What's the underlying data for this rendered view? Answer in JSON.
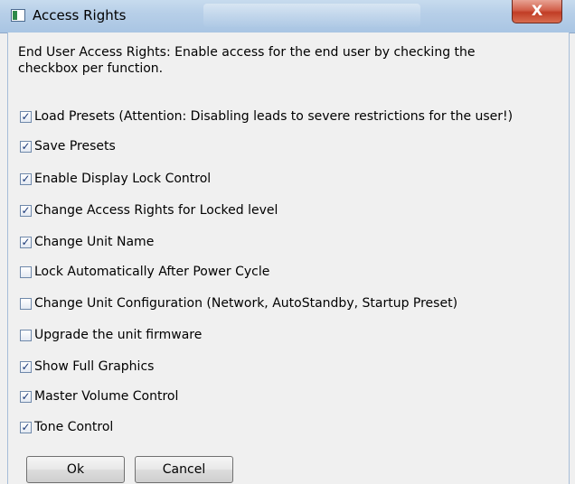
{
  "window": {
    "title": "Access Rights",
    "close_glyph": "X"
  },
  "intro_text": "End User Access Rights: Enable access for the end user by checking the checkbox per function.",
  "options": [
    {
      "label": "Load Presets (Attention: Disabling leads to severe restrictions for the user!)",
      "checked": true
    },
    {
      "label": "Save Presets",
      "checked": true
    },
    {
      "label": "Enable Display Lock Control",
      "checked": true
    },
    {
      "label": "Change Access Rights for Locked level",
      "checked": true
    },
    {
      "label": "Change Unit Name",
      "checked": true
    },
    {
      "label": "Lock Automatically After Power Cycle",
      "checked": false
    },
    {
      "label": "Change Unit Configuration (Network, AutoStandby, Startup Preset)",
      "checked": false
    },
    {
      "label": "Upgrade the unit firmware",
      "checked": false
    },
    {
      "label": "Show Full Graphics",
      "checked": true
    },
    {
      "label": "Master Volume Control",
      "checked": true
    },
    {
      "label": "Tone Control",
      "checked": true
    }
  ],
  "buttons": {
    "ok": "Ok",
    "cancel": "Cancel"
  },
  "icons": {
    "checkmark_glyph": "✓",
    "app_icon": "window-icon",
    "close_icon": "close-icon"
  }
}
